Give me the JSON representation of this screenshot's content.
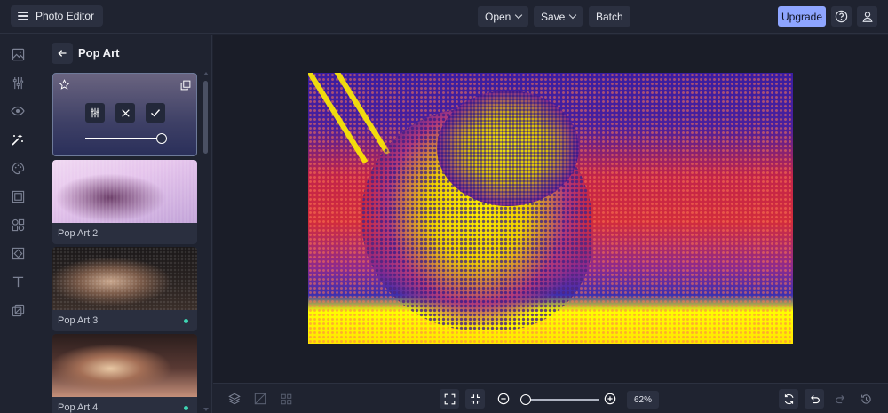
{
  "app": {
    "title": "Photo Editor"
  },
  "toolbar": {
    "open_label": "Open",
    "save_label": "Save",
    "batch_label": "Batch",
    "upgrade_label": "Upgrade"
  },
  "panel": {
    "title": "Pop Art",
    "presets": [
      {
        "label": "Pop Art 2",
        "badge": false
      },
      {
        "label": "Pop Art 3",
        "badge": true
      },
      {
        "label": "Pop Art 4",
        "badge": true
      }
    ],
    "active_intensity": 1.0
  },
  "zoom": {
    "value": "62%",
    "level": 0.0
  },
  "colors": {
    "accent": "#8ea5ff",
    "badge": "#3ed6b4"
  }
}
